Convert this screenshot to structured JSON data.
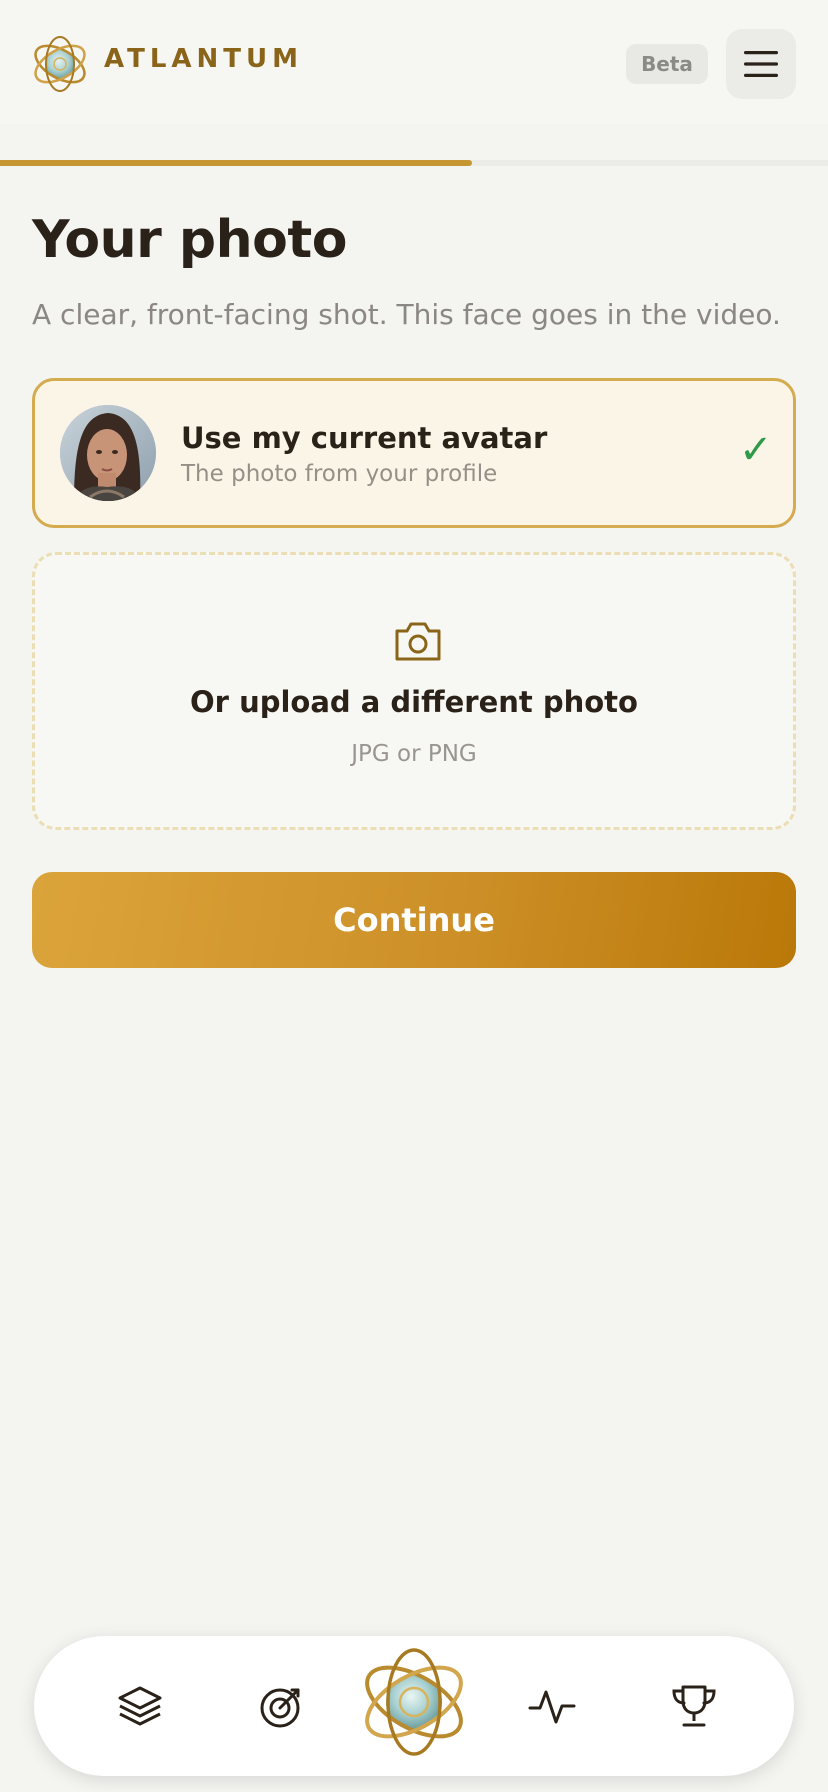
{
  "header": {
    "brand": "ATLANTUM",
    "badge": "Beta",
    "logo_icon": "atlantum-logo-icon",
    "menu_icon": "hamburger-menu-icon"
  },
  "progress": {
    "fraction": 0.57
  },
  "page": {
    "title": "Your photo",
    "subtitle": "A clear, front-facing shot. This face goes in the video."
  },
  "avatar_option": {
    "title": "Use my current avatar",
    "subtitle": "The photo from your profile",
    "check": "✓",
    "selected": true
  },
  "upload_option": {
    "icon": "camera-icon",
    "title": "Or upload a different photo",
    "hint": "JPG or PNG"
  },
  "actions": {
    "continue_label": "Continue"
  },
  "bottom_nav": {
    "items": [
      "layers-icon",
      "target-icon",
      "atlantum-orb-icon",
      "activity-icon",
      "trophy-icon"
    ]
  },
  "colors": {
    "accent": "#c69632",
    "brand_text": "#8a6418",
    "check": "#2f9a4a",
    "background": "#f4f4f1"
  }
}
